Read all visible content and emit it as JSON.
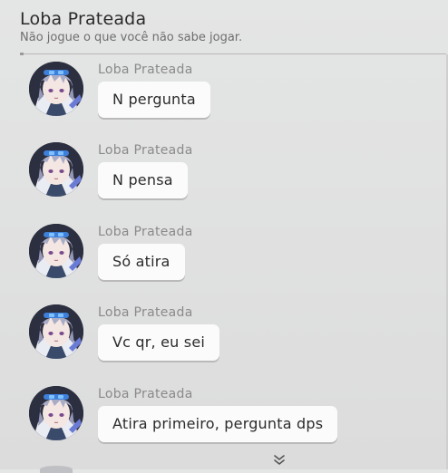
{
  "header": {
    "title": "Loba Prateada",
    "subtitle": "Não jogue o que você não sabe jogar."
  },
  "messages": [
    {
      "sender": "Loba Prateada",
      "text": "N pergunta"
    },
    {
      "sender": "Loba Prateada",
      "text": "N pensa"
    },
    {
      "sender": "Loba Prateada",
      "text": "Só atira"
    },
    {
      "sender": "Loba Prateada",
      "text": "Vc qr, eu sei"
    },
    {
      "sender": "Loba Prateada",
      "text": "Atira primeiro, pergunta dps"
    }
  ],
  "icons": {
    "avatar": "silver-wolf-avatar-icon",
    "scroll": "chevron-double-down-icon"
  },
  "colors": {
    "background": "#e0e0e0",
    "bubble": "#fbfbfb",
    "sender_text": "#8a8a8a",
    "title_text": "#2a2a2a"
  }
}
